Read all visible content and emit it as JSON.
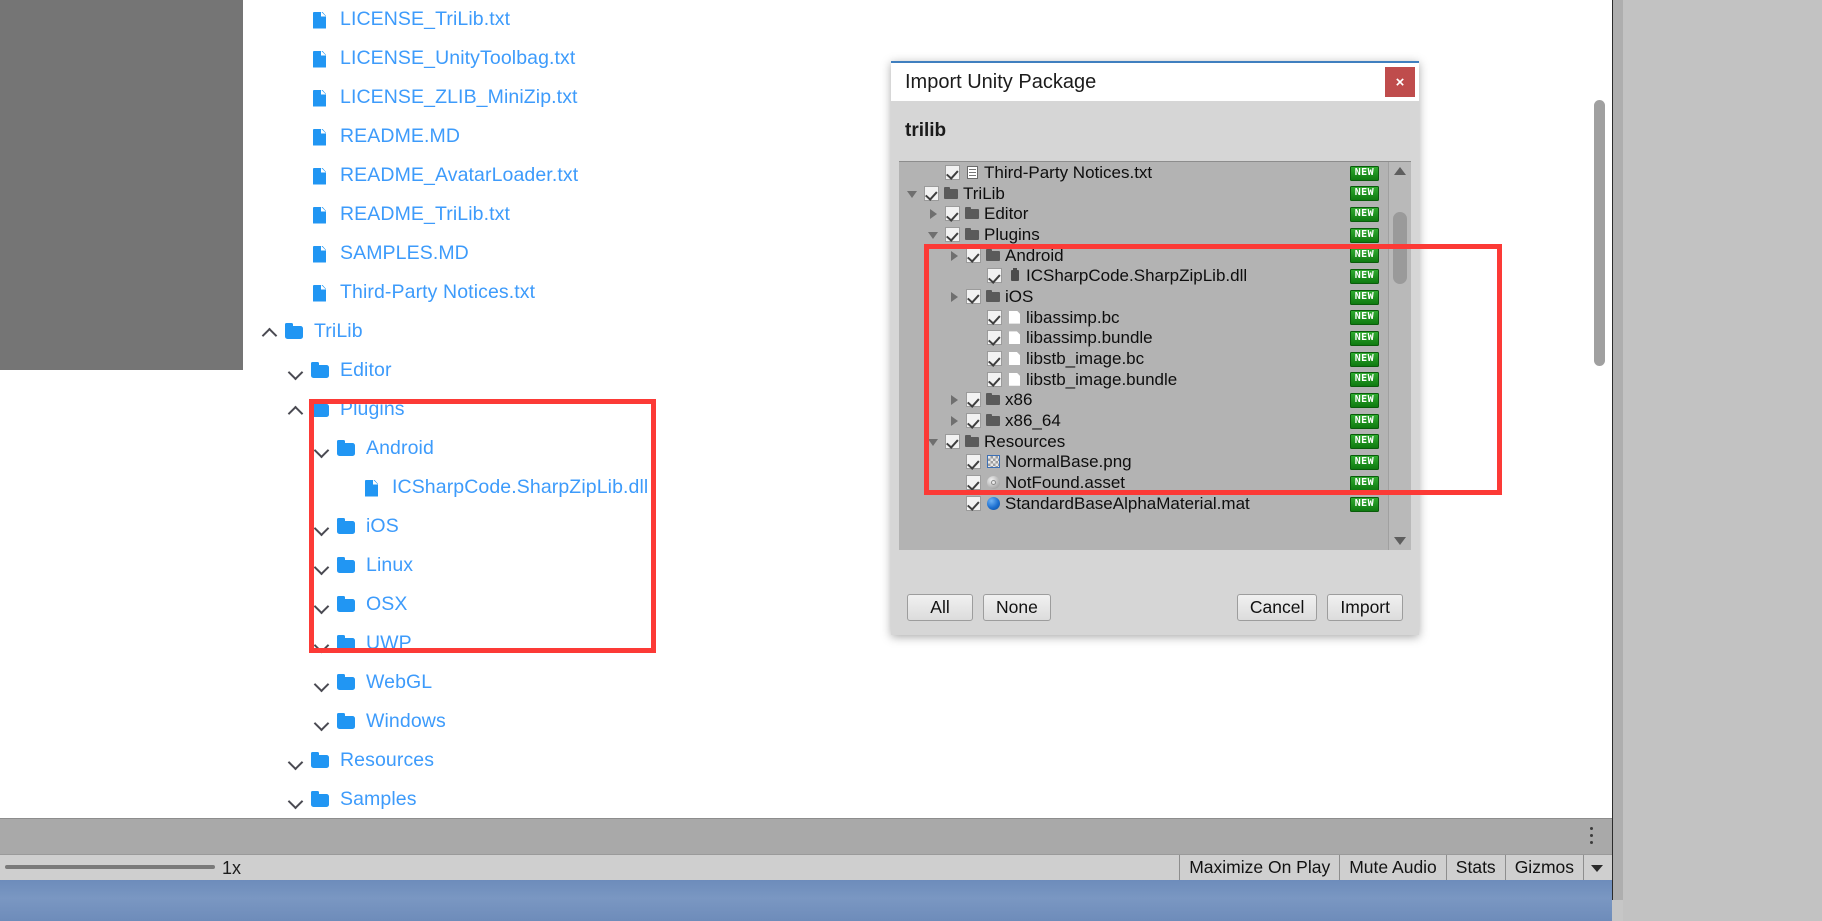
{
  "colors": {
    "link_blue": "#3d9bfb",
    "annotation_red": "#fc3a36",
    "new_badge_green": "#16881a",
    "close_red": "#bf4c4c",
    "dialog_bg": "#d6d6d6"
  },
  "project_tree": {
    "items": [
      {
        "label": "LICENSE_TriLib.txt",
        "icon": "file-icon",
        "indent": 1,
        "chevron": "none"
      },
      {
        "label": "LICENSE_UnityToolbag.txt",
        "icon": "file-icon",
        "indent": 1,
        "chevron": "none"
      },
      {
        "label": "LICENSE_ZLIB_MiniZip.txt",
        "icon": "file-icon",
        "indent": 1,
        "chevron": "none"
      },
      {
        "label": "README.MD",
        "icon": "file-icon",
        "indent": 1,
        "chevron": "none"
      },
      {
        "label": "README_AvatarLoader.txt",
        "icon": "file-icon",
        "indent": 1,
        "chevron": "none"
      },
      {
        "label": "README_TriLib.txt",
        "icon": "file-icon",
        "indent": 1,
        "chevron": "none"
      },
      {
        "label": "SAMPLES.MD",
        "icon": "file-icon",
        "indent": 1,
        "chevron": "none"
      },
      {
        "label": "Third-Party Notices.txt",
        "icon": "file-icon",
        "indent": 1,
        "chevron": "none"
      },
      {
        "label": "TriLib",
        "icon": "folder-icon",
        "indent": 0,
        "chevron": "up"
      },
      {
        "label": "Editor",
        "icon": "folder-icon",
        "indent": 1,
        "chevron": "down"
      },
      {
        "label": "Plugins",
        "icon": "folder-icon",
        "indent": 1,
        "chevron": "up"
      },
      {
        "label": "Android",
        "icon": "folder-icon",
        "indent": 2,
        "chevron": "down"
      },
      {
        "label": "ICSharpCode.SharpZipLib.dll",
        "icon": "file-icon",
        "indent": 3,
        "chevron": "none"
      },
      {
        "label": "iOS",
        "icon": "folder-icon",
        "indent": 2,
        "chevron": "down"
      },
      {
        "label": "Linux",
        "icon": "folder-icon",
        "indent": 2,
        "chevron": "down"
      },
      {
        "label": "OSX",
        "icon": "folder-icon",
        "indent": 2,
        "chevron": "down"
      },
      {
        "label": "UWP",
        "icon": "folder-icon",
        "indent": 2,
        "chevron": "down"
      },
      {
        "label": "WebGL",
        "icon": "folder-icon",
        "indent": 2,
        "chevron": "down"
      },
      {
        "label": "Windows",
        "icon": "folder-icon",
        "indent": 2,
        "chevron": "down"
      },
      {
        "label": "Resources",
        "icon": "folder-icon",
        "indent": 1,
        "chevron": "down"
      },
      {
        "label": "Samples",
        "icon": "folder-icon",
        "indent": 1,
        "chevron": "down"
      }
    ]
  },
  "dialog": {
    "title": "Import Unity Package",
    "close_label": "×",
    "package_name": "trilib",
    "new_badge_text": "NEW",
    "buttons": {
      "all": "All",
      "none": "None",
      "cancel": "Cancel",
      "import": "Import"
    },
    "rows": [
      {
        "name": "Third-Party Notices.txt",
        "icon": "text-doc-icon",
        "indent": 1,
        "arrow": "none",
        "checked": true,
        "badge": "NEW"
      },
      {
        "name": "TriLib",
        "icon": "folder-icon",
        "indent": 0,
        "arrow": "down",
        "checked": true,
        "badge": "NEW"
      },
      {
        "name": "Editor",
        "icon": "folder-icon",
        "indent": 1,
        "arrow": "right",
        "checked": true,
        "badge": "NEW"
      },
      {
        "name": "Plugins",
        "icon": "folder-icon",
        "indent": 1,
        "arrow": "down",
        "checked": true,
        "badge": "NEW"
      },
      {
        "name": "Android",
        "icon": "folder-icon",
        "indent": 2,
        "arrow": "right",
        "checked": true,
        "badge": "NEW"
      },
      {
        "name": "ICSharpCode.SharpZipLib.dll",
        "icon": "dll-icon",
        "indent": 3,
        "arrow": "none",
        "checked": true,
        "badge": "NEW"
      },
      {
        "name": "iOS",
        "icon": "folder-icon",
        "indent": 2,
        "arrow": "right",
        "checked": true,
        "badge": "NEW"
      },
      {
        "name": "libassimp.bc",
        "icon": "blank-doc-icon",
        "indent": 3,
        "arrow": "none",
        "checked": true,
        "badge": "NEW"
      },
      {
        "name": "libassimp.bundle",
        "icon": "blank-doc-icon",
        "indent": 3,
        "arrow": "none",
        "checked": true,
        "badge": "NEW"
      },
      {
        "name": "libstb_image.bc",
        "icon": "blank-doc-icon",
        "indent": 3,
        "arrow": "none",
        "checked": true,
        "badge": "NEW"
      },
      {
        "name": "libstb_image.bundle",
        "icon": "blank-doc-icon",
        "indent": 3,
        "arrow": "none",
        "checked": true,
        "badge": "NEW"
      },
      {
        "name": "x86",
        "icon": "folder-icon",
        "indent": 2,
        "arrow": "right",
        "checked": true,
        "badge": "NEW"
      },
      {
        "name": "x86_64",
        "icon": "folder-icon",
        "indent": 2,
        "arrow": "right",
        "checked": true,
        "badge": "NEW"
      },
      {
        "name": "Resources",
        "icon": "folder-icon",
        "indent": 1,
        "arrow": "down",
        "checked": true,
        "badge": "NEW"
      },
      {
        "name": "NormalBase.png",
        "icon": "texture-icon",
        "indent": 2,
        "arrow": "none",
        "checked": true,
        "badge": "NEW"
      },
      {
        "name": "NotFound.asset",
        "icon": "asset-icon",
        "indent": 2,
        "arrow": "none",
        "checked": true,
        "badge": "NEW"
      },
      {
        "name": "StandardBaseAlphaMaterial.mat",
        "icon": "material-icon",
        "indent": 2,
        "arrow": "none",
        "checked": true,
        "badge": "NEW"
      }
    ]
  },
  "bottom_bar": {
    "zoom_label": "1x",
    "buttons": [
      "Maximize On Play",
      "Mute Audio",
      "Stats",
      "Gizmos"
    ]
  }
}
